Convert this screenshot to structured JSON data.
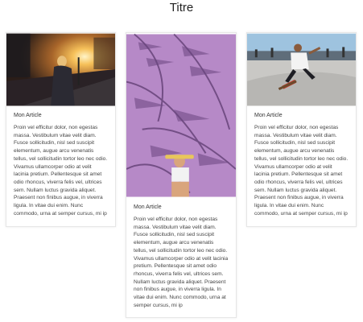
{
  "page": {
    "title": "Titre"
  },
  "articles": [
    {
      "title": "Mon Article",
      "text": "Proin vel efficitur dolor, non egestas massa. Vestibulum vitae velit diam. Fusce sollicitudin, nisl sed suscipit elementum, augue arcu venenatis tellus, vel sollicitudin tortor leo nec odio. Vivamus ullamcorper odio at velit lacinia pretium. Pellentesque sit amet odio rhoncus, viverra felis vel, ultrices sem. Nullam luctus gravida aliquet. Praesent non finibus augue, in viverra ligula. In vitae dui enim. Nunc commodo, urna at semper cursus, mi ip"
    },
    {
      "title": "Mon Article",
      "text": "Proin vel efficitur dolor, non egestas massa. Vestibulum vitae velit diam. Fusce sollicitudin, nisl sed suscipit elementum, augue arcu venenatis tellus, vel sollicitudin tortor leo nec odio. Vivamus ullamcorper odio at velit lacinia pretium. Pellentesque sit amet odio rhoncus, viverra felis vel, ultrices sem. Nullam luctus gravida aliquet. Praesent non finibus augue, in viverra ligula. In vitae dui enim. Nunc commodo, urna at semper cursus, mi ip"
    },
    {
      "title": "Mon Article",
      "text": "Proin vel efficitur dolor, non egestas massa. Vestibulum vitae velit diam. Fusce sollicitudin, nisl sed suscipit elementum, augue arcu venenatis tellus, vel sollicitudin tortor leo nec odio. Vivamus ullamcorper odio at velit lacinia pretium. Pellentesque sit amet odio rhoncus, viverra felis vel, ultrices sem. Nullam luctus gravida aliquet. Praesent non finibus augue, in viverra ligula. In vitae dui enim. Nunc commodo, urna at semper cursus, mi ip"
    }
  ]
}
